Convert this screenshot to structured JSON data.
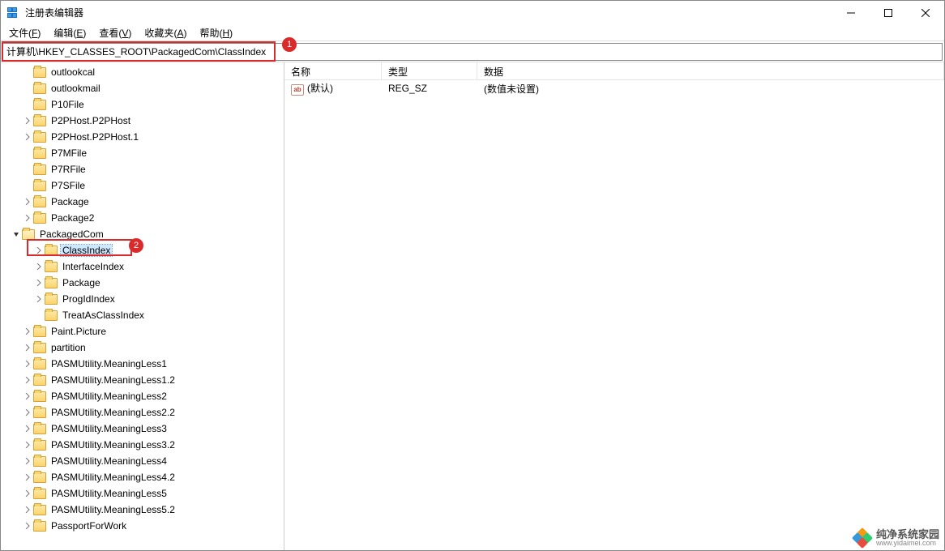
{
  "window": {
    "title": "注册表编辑器"
  },
  "win_controls": {
    "min": "—",
    "max": "▢",
    "close": "✕"
  },
  "menu": {
    "file": {
      "label": "文件",
      "accel": "F"
    },
    "edit": {
      "label": "编辑",
      "accel": "E"
    },
    "view": {
      "label": "查看",
      "accel": "V"
    },
    "fav": {
      "label": "收藏夹",
      "accel": "A"
    },
    "help": {
      "label": "帮助",
      "accel": "H"
    }
  },
  "address": "计算机\\HKEY_CLASSES_ROOT\\PackagedCom\\ClassIndex",
  "callouts": {
    "one": "1",
    "two": "2"
  },
  "tree": [
    {
      "indent": 40,
      "chev": "",
      "label": "outlookcal"
    },
    {
      "indent": 40,
      "chev": "",
      "label": "outlookmail"
    },
    {
      "indent": 40,
      "chev": "",
      "label": "P10File"
    },
    {
      "indent": 40,
      "chev": ">",
      "label": "P2PHost.P2PHost"
    },
    {
      "indent": 40,
      "chev": ">",
      "label": "P2PHost.P2PHost.1"
    },
    {
      "indent": 40,
      "chev": "",
      "label": "P7MFile"
    },
    {
      "indent": 40,
      "chev": "",
      "label": "P7RFile"
    },
    {
      "indent": 40,
      "chev": "",
      "label": "P7SFile"
    },
    {
      "indent": 40,
      "chev": ">",
      "label": "Package"
    },
    {
      "indent": 40,
      "chev": ">",
      "label": "Package2"
    },
    {
      "indent": 26,
      "chev": "v",
      "label": "PackagedCom",
      "open": true
    },
    {
      "indent": 54,
      "chev": ">",
      "label": "ClassIndex",
      "selected": true
    },
    {
      "indent": 54,
      "chev": ">",
      "label": "InterfaceIndex"
    },
    {
      "indent": 54,
      "chev": ">",
      "label": "Package"
    },
    {
      "indent": 54,
      "chev": ">",
      "label": "ProgIdIndex"
    },
    {
      "indent": 54,
      "chev": "",
      "label": "TreatAsClassIndex"
    },
    {
      "indent": 40,
      "chev": ">",
      "label": "Paint.Picture"
    },
    {
      "indent": 40,
      "chev": ">",
      "label": "partition"
    },
    {
      "indent": 40,
      "chev": ">",
      "label": "PASMUtility.MeaningLess1"
    },
    {
      "indent": 40,
      "chev": ">",
      "label": "PASMUtility.MeaningLess1.2"
    },
    {
      "indent": 40,
      "chev": ">",
      "label": "PASMUtility.MeaningLess2"
    },
    {
      "indent": 40,
      "chev": ">",
      "label": "PASMUtility.MeaningLess2.2"
    },
    {
      "indent": 40,
      "chev": ">",
      "label": "PASMUtility.MeaningLess3"
    },
    {
      "indent": 40,
      "chev": ">",
      "label": "PASMUtility.MeaningLess3.2"
    },
    {
      "indent": 40,
      "chev": ">",
      "label": "PASMUtility.MeaningLess4"
    },
    {
      "indent": 40,
      "chev": ">",
      "label": "PASMUtility.MeaningLess4.2"
    },
    {
      "indent": 40,
      "chev": ">",
      "label": "PASMUtility.MeaningLess5"
    },
    {
      "indent": 40,
      "chev": ">",
      "label": "PASMUtility.MeaningLess5.2"
    },
    {
      "indent": 40,
      "chev": ">",
      "label": "PassportForWork"
    }
  ],
  "list": {
    "headers": {
      "name": "名称",
      "type": "类型",
      "data": "数据"
    },
    "rows": [
      {
        "icon": "ab",
        "name": "(默认)",
        "type": "REG_SZ",
        "data": "(数值未设置)"
      }
    ]
  },
  "watermark": {
    "line1": "纯净系统家园",
    "line2": "www.yidaimei.com"
  }
}
